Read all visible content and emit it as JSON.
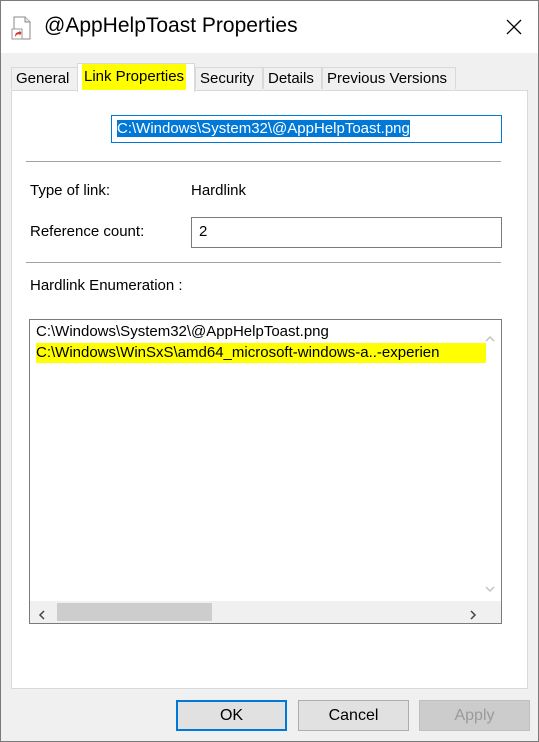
{
  "window": {
    "title": "@AppHelpToast Properties",
    "close_symbol": "✕"
  },
  "tabs": [
    {
      "label": "General"
    },
    {
      "label": "Link Properties",
      "active": true
    },
    {
      "label": "Security"
    },
    {
      "label": "Details"
    },
    {
      "label": "Previous Versions"
    }
  ],
  "link_properties": {
    "path": "C:\\Windows\\System32\\@AppHelpToast.png",
    "type_label": "Type of link:",
    "type_value": "Hardlink",
    "ref_label": "Reference count:",
    "ref_value": "2",
    "enum_label": "Hardlink Enumeration :",
    "enum_items": [
      "C:\\Windows\\System32\\@AppHelpToast.png",
      "C:\\Windows\\WinSxS\\amd64_microsoft-windows-a..-experien"
    ]
  },
  "buttons": {
    "ok": "OK",
    "cancel": "Cancel",
    "apply": "Apply"
  },
  "colors": {
    "highlight": "#ffff00",
    "selection": "#0078d7"
  },
  "icons": {
    "title": "file-shortcut-icon",
    "close": "close-icon"
  }
}
